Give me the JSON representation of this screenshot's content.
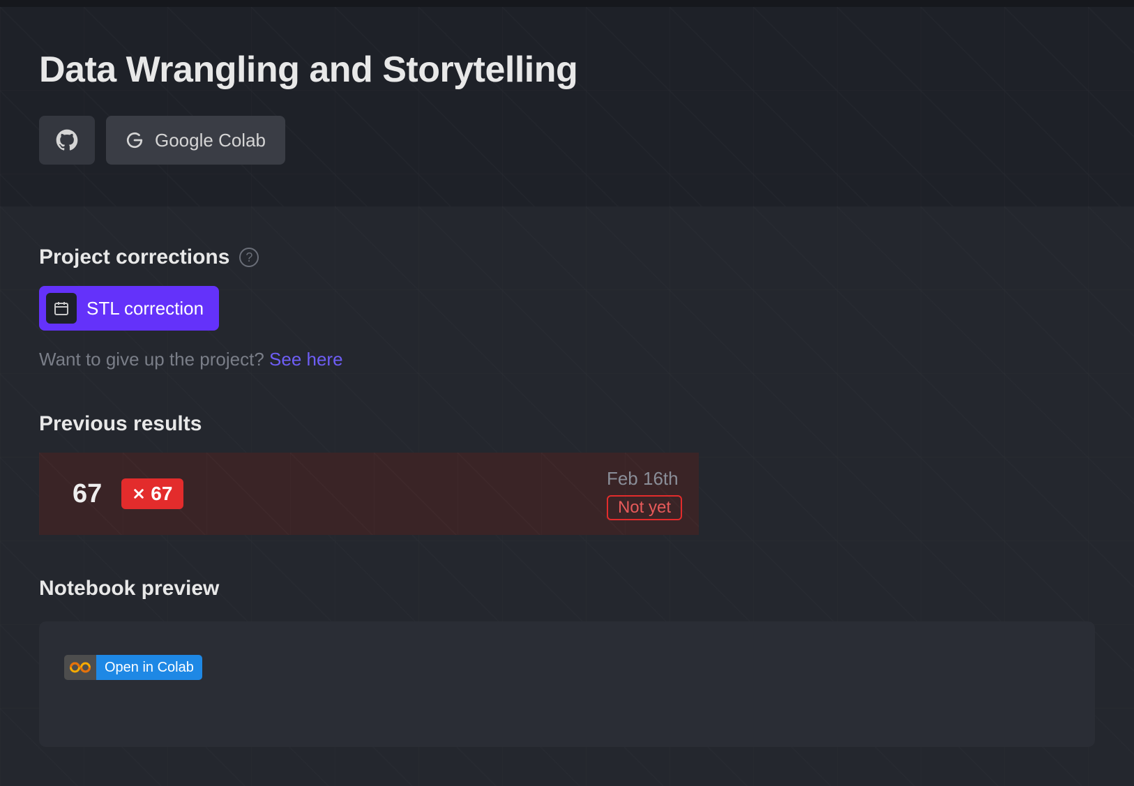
{
  "header": {
    "title": "Data Wrangling and Storytelling",
    "colab_button": "Google Colab"
  },
  "corrections": {
    "title": "Project corrections",
    "stl_label": "STL correction",
    "giveup_text": "Want to give up the project? ",
    "giveup_link": "See here"
  },
  "previous": {
    "title": "Previous results",
    "score": "67",
    "badge_score": "67",
    "date": "Feb 16th",
    "status": "Not yet"
  },
  "notebook": {
    "title": "Notebook preview",
    "open_label": "Open in Colab"
  }
}
